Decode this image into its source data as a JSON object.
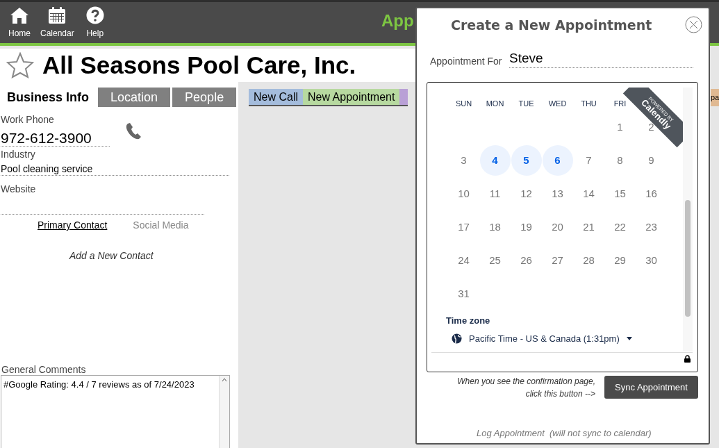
{
  "toolbar": [
    {
      "label": "Home",
      "kind": "home"
    },
    {
      "label": "Calendar",
      "kind": "calendar"
    },
    {
      "label": "Help",
      "kind": "help"
    }
  ],
  "app_title": "App",
  "company": {
    "name": "All Seasons Pool Care, Inc.",
    "favorite": false
  },
  "left_tabs": [
    {
      "label": "Business Info",
      "selected": true
    },
    {
      "label": "Location",
      "selected": false
    },
    {
      "label": "People",
      "selected": false
    }
  ],
  "fields": [
    {
      "label": "Work Phone",
      "value": "972-612-3900",
      "kind": "phone"
    },
    {
      "label": "Industry",
      "value": "Pool cleaning service",
      "kind": "text"
    },
    {
      "label": "Website",
      "kind": "text"
    }
  ],
  "contact_tabs": [
    {
      "label": "Primary Contact",
      "selected": true
    },
    {
      "label": "Social Media",
      "selected": false
    }
  ],
  "add_contact": "Add a New Contact",
  "comments": {
    "label": "General Comments",
    "value": "#Google Rating: 4.4 / 7 reviews as of 7/24/2023"
  },
  "action_tabs": [
    {
      "label": "New Call",
      "color": "#a4bcdc"
    },
    {
      "label": "New Appointment",
      "color": "#b7d9a0"
    },
    {
      "color": "#b9a0d6"
    }
  ],
  "right_tab": {
    "label": "pa",
    "color": "#e0b992"
  },
  "modal": {
    "title": "Create a New Appointment",
    "for_label": "Appointment For",
    "for_value": "Steve",
    "badge_small": "POWERED BY",
    "badge_brand": "Calendly",
    "weekdays": [
      "SUN",
      "MON",
      "TUE",
      "WED",
      "THU",
      "FRI"
    ],
    "weeks": [
      [
        {
          "label": "1",
          "available": false
        },
        {
          "label": "2",
          "available": false
        }
      ],
      [
        {
          "label": "3",
          "available": false
        },
        {
          "label": "4",
          "available": true
        },
        {
          "label": "5",
          "available": true
        },
        {
          "label": "6",
          "available": true
        },
        {
          "label": "7",
          "available": false
        },
        {
          "label": "8",
          "available": false
        },
        {
          "label": "9",
          "available": false
        }
      ],
      [
        {
          "label": "10",
          "available": false
        },
        {
          "label": "11",
          "available": false
        },
        {
          "label": "12",
          "available": false
        },
        {
          "label": "13",
          "available": false
        },
        {
          "label": "14",
          "available": false
        },
        {
          "label": "15",
          "available": false
        },
        {
          "label": "16",
          "available": false
        }
      ],
      [
        {
          "label": "17",
          "available": false
        },
        {
          "label": "18",
          "available": false
        },
        {
          "label": "19",
          "available": false
        },
        {
          "label": "20",
          "available": false
        },
        {
          "label": "21",
          "available": false
        },
        {
          "label": "22",
          "available": false
        },
        {
          "label": "23",
          "available": false
        }
      ],
      [
        {
          "label": "24",
          "available": false
        },
        {
          "label": "25",
          "available": false
        },
        {
          "label": "26",
          "available": false
        },
        {
          "label": "27",
          "available": false
        },
        {
          "label": "28",
          "available": false
        },
        {
          "label": "29",
          "available": false
        },
        {
          "label": "30",
          "available": false
        }
      ],
      [
        {
          "label": "31",
          "available": false
        }
      ]
    ],
    "timezone_label": "Time zone",
    "timezone_value": "Pacific Time - US & Canada (1:31pm)",
    "sync_hint": [
      "When you see the confirmation page,",
      "click this button -->"
    ],
    "sync_button": "Sync Appointment",
    "log_link": "Log Appointment  (will not sync to calendar)"
  }
}
